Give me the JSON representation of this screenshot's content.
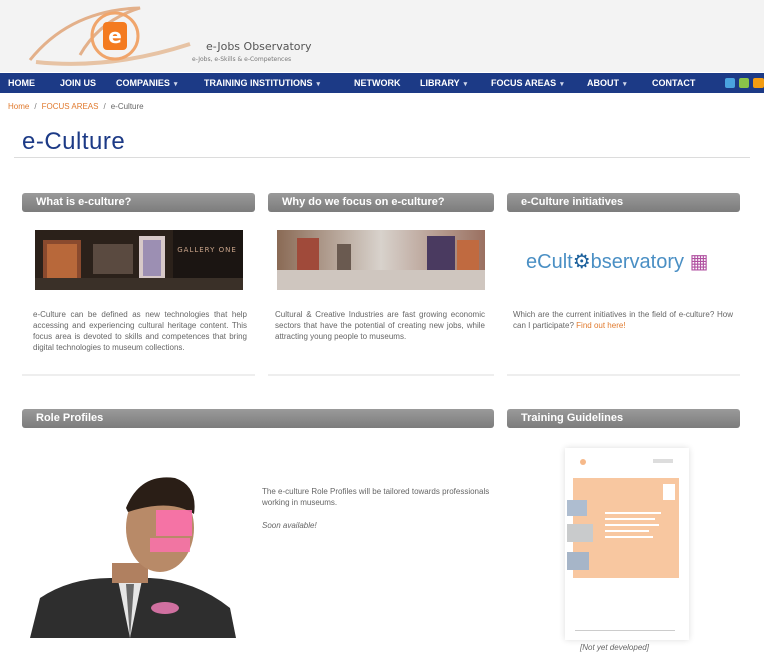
{
  "brand": {
    "title": "e-Jobs Observatory",
    "subtitle": "e-Jobs, e-Skills & e-Competences",
    "logo_letter": "e"
  },
  "nav": {
    "items": [
      {
        "label": "HOME",
        "dropdown": false
      },
      {
        "label": "JOIN US",
        "dropdown": false
      },
      {
        "label": "COMPANIES",
        "dropdown": true
      },
      {
        "label": "TRAINING INSTITUTIONS",
        "dropdown": true
      },
      {
        "label": "NETWORK",
        "dropdown": false
      },
      {
        "label": "LIBRARY",
        "dropdown": true
      },
      {
        "label": "FOCUS AREAS",
        "dropdown": true
      },
      {
        "label": "ABOUT",
        "dropdown": true
      },
      {
        "label": "CONTACT",
        "dropdown": false
      }
    ],
    "caret": "▾",
    "social_icons": [
      "twitter-icon",
      "share-icon",
      "rss-icon"
    ]
  },
  "breadcrumb": {
    "home": "Home",
    "parent": "FOCUS AREAS",
    "current": "e-Culture",
    "sep": "/"
  },
  "page": {
    "title": "e-Culture"
  },
  "sections": {
    "what": {
      "title": "What is e-culture?",
      "body": "e-Culture can be defined as new technologies that help accessing and experiencing cultural heritage content. This focus area is devoted to skills and competences that bring digital technologies to museum collections.",
      "image_caption": "GALLERY ONE"
    },
    "why": {
      "title": "Why do we focus on e-culture?",
      "body": "Cultural & Creative Industries are fast growing economic sectors that have the potential of creating new jobs, while attracting young people to museums."
    },
    "initiatives": {
      "title": "e-Culture initiatives",
      "logo_text_pre": "eCult",
      "logo_text_post": "bservatory",
      "body": "Which are the current initiatives in the field of e-culture? How can I participate?",
      "link": "Find out here!"
    },
    "roles": {
      "title": "Role Profiles",
      "body": "The e-culture Role Profiles will be tailored towards professionals working in museums.",
      "status": "Soon available!"
    },
    "training": {
      "title": "Training Guidelines",
      "status": "[Not yet developed]"
    }
  },
  "colors": {
    "nav_bg": "#1c3a86",
    "accent_orange": "#e07a2e",
    "title_blue": "#1c3a86",
    "bar_grey": "#8a8a8a"
  }
}
